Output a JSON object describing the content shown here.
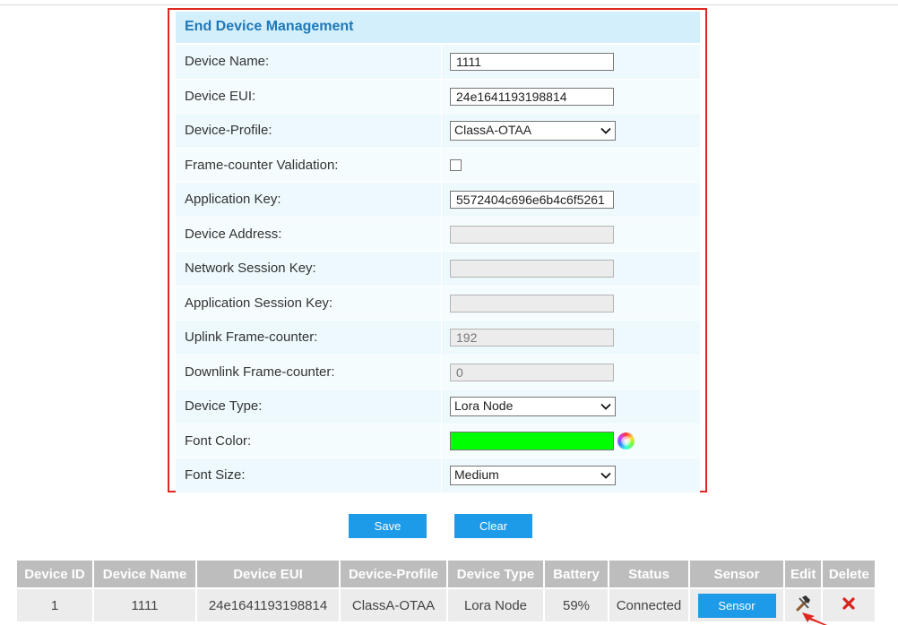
{
  "panel": {
    "title": "End Device Management",
    "fields": {
      "device_name": {
        "label": "Device Name:",
        "value": "1111"
      },
      "device_eui": {
        "label": "Device EUI:",
        "value": "24e1641193198814"
      },
      "device_profile": {
        "label": "Device-Profile:",
        "value": "ClassA-OTAA"
      },
      "frame_counter_validation": {
        "label": "Frame-counter Validation:",
        "checked": false
      },
      "application_key": {
        "label": "Application Key:",
        "value": "5572404c696e6b4c6f5261"
      },
      "device_address": {
        "label": "Device Address:",
        "value": ""
      },
      "network_session_key": {
        "label": "Network Session Key:",
        "value": ""
      },
      "application_session_key": {
        "label": "Application Session Key:",
        "value": ""
      },
      "uplink_frame_counter": {
        "label": "Uplink Frame-counter:",
        "value": "192"
      },
      "downlink_frame_counter": {
        "label": "Downlink Frame-counter:",
        "value": "0"
      },
      "device_type": {
        "label": "Device Type:",
        "value": "Lora Node"
      },
      "font_color": {
        "label": "Font Color:",
        "value": "#00ff00"
      },
      "font_size": {
        "label": "Font Size:",
        "value": "Medium"
      }
    }
  },
  "buttons": {
    "save": "Save",
    "clear": "Clear"
  },
  "table": {
    "headers": [
      "Device ID",
      "Device Name",
      "Device EUI",
      "Device-Profile",
      "Device Type",
      "Battery",
      "Status",
      "Sensor",
      "Edit",
      "Delete"
    ],
    "rows": [
      {
        "device_id": "1",
        "device_name": "1111",
        "device_eui": "24e1641193198814",
        "device_profile": "ClassA-OTAA",
        "device_type": "Lora Node",
        "battery": "59%",
        "status": "Connected",
        "sensor_button": "Sensor"
      }
    ]
  },
  "colors": {
    "accent": "#1e9be8",
    "highlight_border": "#e0271f",
    "title_text": "#1f78b8",
    "font_color_swatch": "#00ff00"
  },
  "icons": [
    "chevron-down-icon",
    "color-wheel-icon",
    "hammer-icon",
    "delete-x-icon",
    "red-arrow-icon"
  ]
}
